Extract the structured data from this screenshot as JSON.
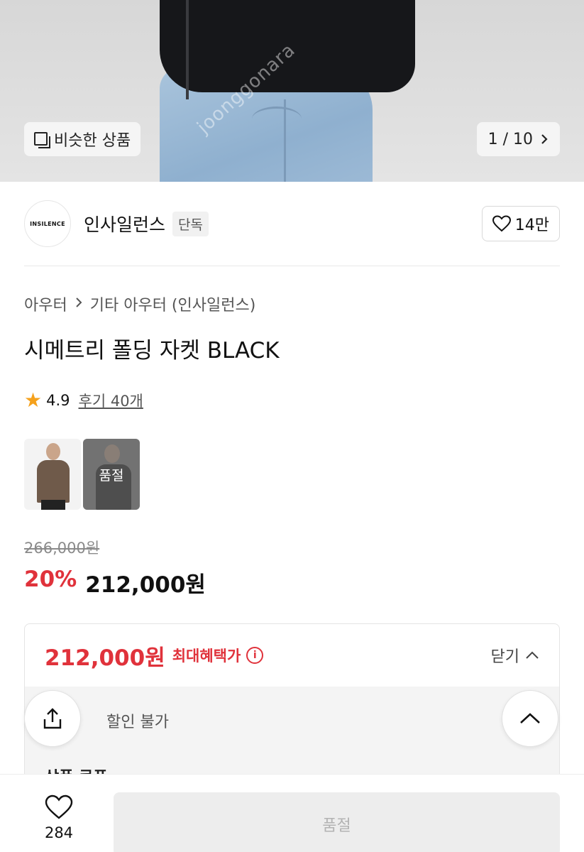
{
  "gallery": {
    "similar_label": "비슷한 상품",
    "pager": "1 / 10",
    "watermark": "joonggonara"
  },
  "brand": {
    "logo_text": "INSILENCE",
    "name": "인사일런스",
    "tag": "단독",
    "likes": "14만"
  },
  "breadcrumb": [
    "아우터",
    "기타 아우터 (인사일런스)"
  ],
  "product": {
    "title": "시메트리 폴딩 자켓 BLACK",
    "rating": "4.9",
    "reviews": "후기 40개",
    "sold_out_overlay": "품절"
  },
  "price": {
    "original": "266,000원",
    "discount_pct": "20%",
    "sale": "212,000원"
  },
  "benefit": {
    "amount": "212,000원",
    "label": "최대혜택가",
    "close_label": "닫기",
    "discount_note": "할인 불가",
    "coupon_label": "상품 쿠폰"
  },
  "bottom": {
    "wish_count": "284",
    "cta_label": "품절"
  },
  "colors": {
    "accent_red": "#e0323b",
    "star": "#f5a11c"
  }
}
